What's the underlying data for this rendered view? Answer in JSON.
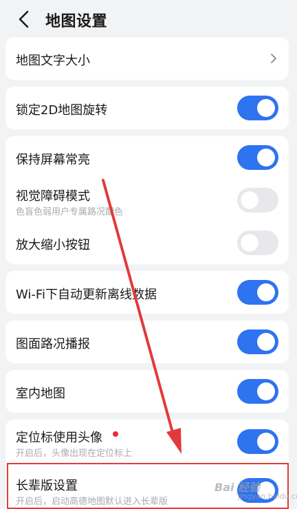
{
  "header": {
    "title": "地图设置",
    "back_icon": "chevron-left-icon"
  },
  "settings": {
    "map_text_size": {
      "label": "地图文字大小"
    },
    "lock_2d_rotation": {
      "label": "锁定2D地图旋转",
      "on": true
    },
    "keep_screen_on": {
      "label": "保持屏幕常亮",
      "on": true
    },
    "visual_impairment": {
      "label": "视觉障碍模式",
      "sublabel": "色盲色弱用户专属路况配色",
      "on": false
    },
    "zoom_buttons": {
      "label": "放大缩小按钮",
      "on": false
    },
    "wifi_offline_update": {
      "label": "Wi-Fi下自动更新离线数据",
      "on": true
    },
    "traffic_broadcast": {
      "label": "图面路况播报",
      "on": true
    },
    "indoor_map": {
      "label": "室内地图",
      "on": true
    },
    "avatar_locator": {
      "label": "定位标使用头像",
      "sublabel": "开启后，头像出现在定位标上",
      "on": true,
      "badge": "red-dot"
    },
    "elder_mode": {
      "label": "长辈版设置",
      "sublabel": "开启后，启动高德地图默认进入长辈版",
      "on": true
    }
  },
  "colors": {
    "accent": "#2e73ef",
    "toggle_off": "#e8e8ec",
    "background": "#f2f3f5",
    "annotation": "#e23a3a"
  },
  "watermark": {
    "text": "Bai 经验",
    "sub": "jingyan.baidu.com"
  }
}
